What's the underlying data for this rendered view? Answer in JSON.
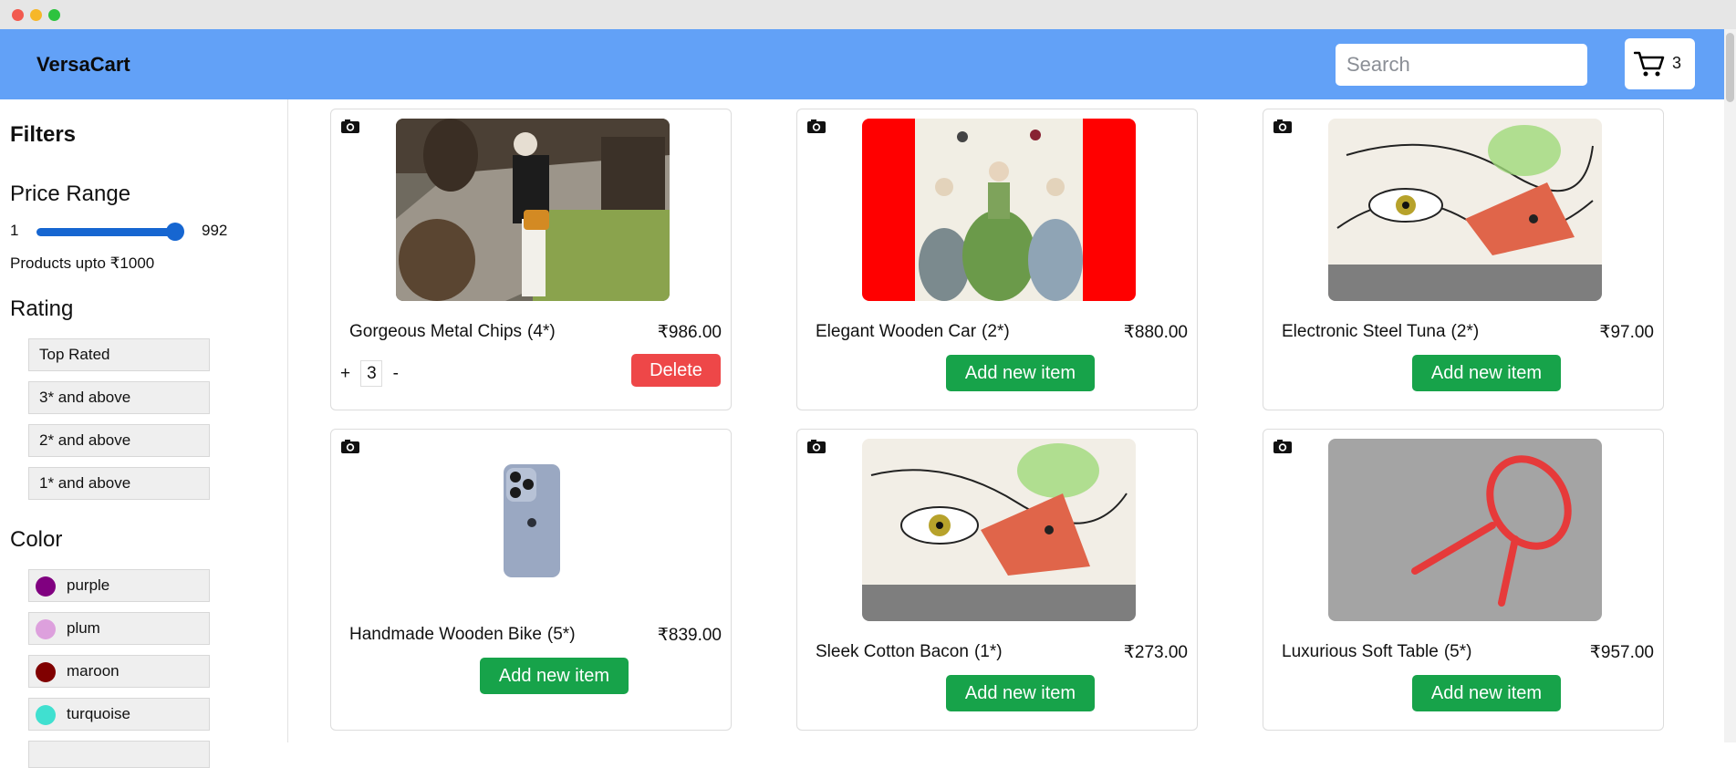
{
  "app": {
    "brand": "VersaCart"
  },
  "search": {
    "placeholder": "Search",
    "value": ""
  },
  "cart": {
    "icon": "cart-icon",
    "count": "3"
  },
  "filters": {
    "title": "Filters",
    "price": {
      "title": "Price Range",
      "min": "1",
      "max": "992",
      "note": "Products upto ₹1000"
    },
    "rating": {
      "title": "Rating",
      "options": [
        "Top Rated",
        "3* and above",
        "2* and above",
        "1* and above"
      ]
    },
    "color": {
      "title": "Color",
      "options": [
        {
          "label": "purple",
          "swatch": "#800080"
        },
        {
          "label": "plum",
          "swatch": "#dda0dd"
        },
        {
          "label": "maroon",
          "swatch": "#800000"
        },
        {
          "label": "turquoise",
          "swatch": "#40e0d0"
        }
      ]
    }
  },
  "products": [
    {
      "name": "Gorgeous Metal Chips",
      "rating": "(4*)",
      "price": "₹986.00",
      "in_cart": true,
      "quantity": "3",
      "plus": "+",
      "minus": "-",
      "delete_label": "Delete"
    },
    {
      "name": "Elegant Wooden Car",
      "rating": "(2*)",
      "price": "₹880.00",
      "button": "Add new item"
    },
    {
      "name": "Electronic Steel Tuna",
      "rating": "(2*)",
      "price": "₹97.00",
      "button": "Add new item"
    },
    {
      "name": "Handmade Wooden Bike",
      "rating": "(5*)",
      "price": "₹839.00",
      "button": "Add new item"
    },
    {
      "name": "Sleek Cotton Bacon",
      "rating": "(1*)",
      "price": "₹273.00",
      "button": "Add new item"
    },
    {
      "name": "Luxurious Soft Table",
      "rating": "(5*)",
      "price": "₹957.00",
      "button": "Add new item"
    }
  ]
}
